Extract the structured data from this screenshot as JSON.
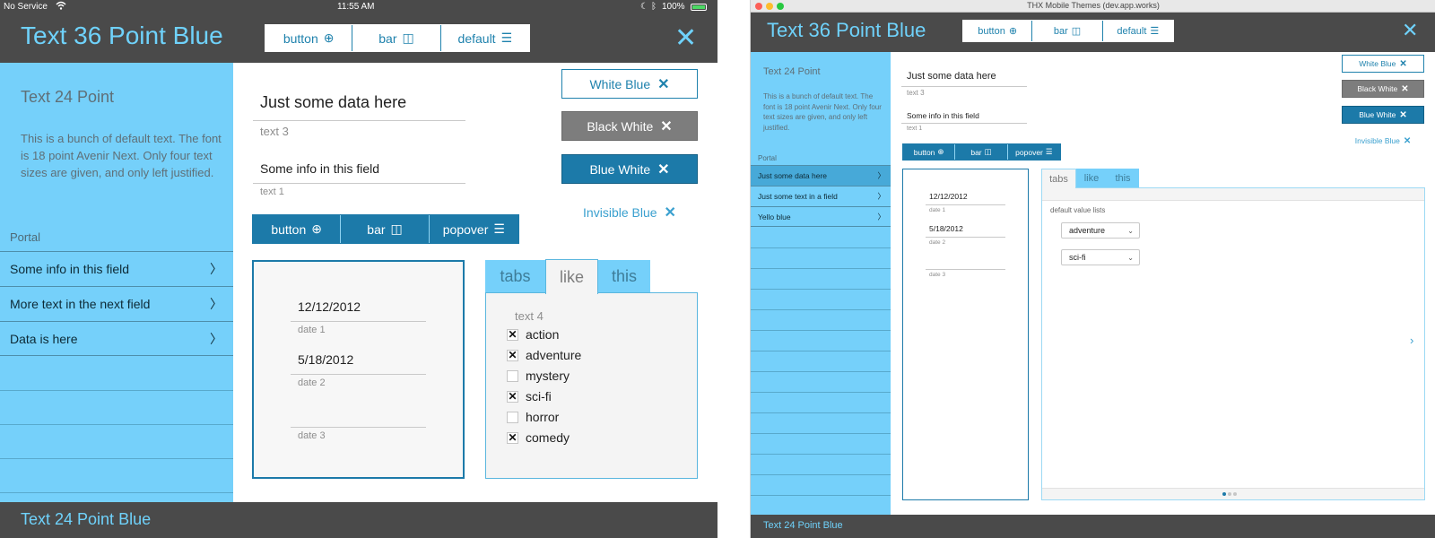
{
  "ipad": {
    "status": {
      "carrier": "No Service",
      "wifi_icon": "wifi-icon",
      "time": "11:55 AM",
      "battery": "100%"
    },
    "title": "Text 36 Point Blue",
    "segmented": [
      {
        "label": "button",
        "icon": "⊕"
      },
      {
        "label": "bar",
        "icon": "◫"
      },
      {
        "label": "default",
        "icon": "☰"
      }
    ],
    "close": "✕",
    "sidebar": {
      "title": "Text 24 Point",
      "body": "This is a bunch of default text. The font is 18 point Avenir Next. Only four text sizes are given, and only left justified.",
      "portal": "Portal",
      "items": [
        {
          "label": "Some info in this field"
        },
        {
          "label": "More text in the next field"
        },
        {
          "label": "Data is here"
        }
      ],
      "chevron": "〉"
    },
    "fields": [
      {
        "value": "Just some data here",
        "label": "text 3"
      },
      {
        "value": "Some info in this field",
        "label": "text 1"
      }
    ],
    "blue_segmented": [
      {
        "label": "button",
        "icon": "⊕"
      },
      {
        "label": "bar",
        "icon": "◫"
      },
      {
        "label": "popover",
        "icon": "☰"
      }
    ],
    "buttons": [
      {
        "label": "White Blue",
        "icon": "✕"
      },
      {
        "label": "Black White",
        "icon": "✕"
      },
      {
        "label": "Blue White",
        "icon": "✕"
      },
      {
        "label": "Invisible Blue",
        "icon": "✕"
      }
    ],
    "dates": [
      {
        "value": "12/12/2012",
        "label": "date 1"
      },
      {
        "value": "5/18/2012",
        "label": "date 2"
      },
      {
        "value": "",
        "label": "date 3"
      }
    ],
    "tabs": [
      {
        "label": "tabs"
      },
      {
        "label": "like"
      },
      {
        "label": "this"
      }
    ],
    "tab_panel": {
      "heading": "text 4",
      "options": [
        {
          "label": "action",
          "checked": true
        },
        {
          "label": "adventure",
          "checked": true
        },
        {
          "label": "mystery",
          "checked": false
        },
        {
          "label": "sci-fi",
          "checked": true
        },
        {
          "label": "horror",
          "checked": false
        },
        {
          "label": "comedy",
          "checked": true
        }
      ]
    },
    "footer": "Text 24 Point Blue"
  },
  "mac": {
    "window_title": "THX Mobile Themes (dev.app.works)",
    "title": "Text 36 Point Blue",
    "segmented": [
      {
        "label": "button",
        "icon": "⊕"
      },
      {
        "label": "bar",
        "icon": "◫"
      },
      {
        "label": "default",
        "icon": "☰"
      }
    ],
    "close": "✕",
    "sidebar": {
      "title": "Text 24 Point",
      "body": "This is a bunch of default text. The font is 18 point Avenir Next. Only four text sizes are given, and only left justified.",
      "portal": "Portal",
      "items": [
        {
          "label": "Just some data here",
          "selected": true
        },
        {
          "label": "Just some text in a field",
          "selected": false
        },
        {
          "label": "Yello blue",
          "selected": false
        }
      ],
      "chevron": "〉"
    },
    "fields": [
      {
        "value": "Just some data here",
        "label": "text 3"
      },
      {
        "value": "Some info in this field",
        "label": "text 1"
      }
    ],
    "blue_segmented": [
      {
        "label": "button",
        "icon": "⊕"
      },
      {
        "label": "bar",
        "icon": "◫"
      },
      {
        "label": "popover",
        "icon": "☰"
      }
    ],
    "buttons": [
      {
        "label": "White Blue",
        "icon": "✕"
      },
      {
        "label": "Black White",
        "icon": "✕"
      },
      {
        "label": "Blue White",
        "icon": "✕"
      },
      {
        "label": "Invisible Blue",
        "icon": "✕"
      }
    ],
    "dates": [
      {
        "value": "12/12/2012",
        "label": "date 1"
      },
      {
        "value": "5/18/2012",
        "label": "date 2"
      },
      {
        "value": "",
        "label": "date 3"
      }
    ],
    "tabs": [
      {
        "label": "tabs"
      },
      {
        "label": "like"
      },
      {
        "label": "this"
      }
    ],
    "tab_panel": {
      "heading": "default value lists",
      "selects": [
        {
          "value": "adventure"
        },
        {
          "value": "sci-fi"
        }
      ],
      "next_arrow": "›",
      "page_dots": 3,
      "active_page_dot": 1
    },
    "footer": "Text 24 Point Blue"
  },
  "colors": {
    "accent_light": "#6fd2fb",
    "accent_dark": "#1c7aa9",
    "sidebar_bg": "#75d0fa",
    "header_bg": "#4a4a4a"
  }
}
